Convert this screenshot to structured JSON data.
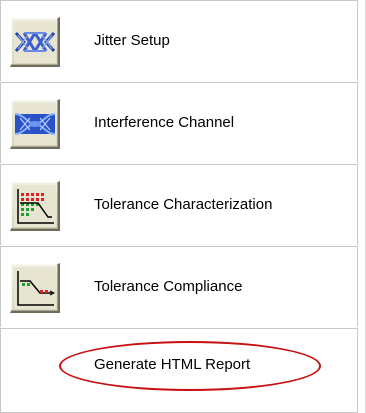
{
  "menu": {
    "items": [
      {
        "label": "Jitter Setup",
        "icon": "jitter-eye-icon"
      },
      {
        "label": "Interference Channel",
        "icon": "interference-eye-icon"
      },
      {
        "label": "Tolerance Characterization",
        "icon": "tolerance-characterization-icon"
      },
      {
        "label": "Tolerance Compliance",
        "icon": "tolerance-compliance-icon"
      }
    ],
    "report_link": "Generate HTML Report"
  },
  "colors": {
    "highlight_oval": "#c81010",
    "icon_blue": "#3a5fd0"
  }
}
